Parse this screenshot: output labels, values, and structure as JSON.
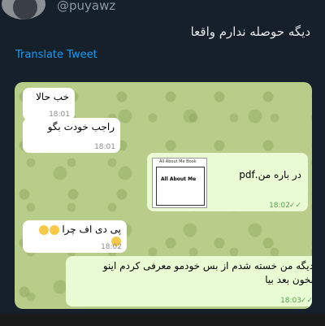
{
  "tweet": {
    "handle": "@puyawz",
    "text": "دیگه حوصله ندارم واقعا",
    "translate_label": "Translate Tweet"
  },
  "chat": {
    "messages": [
      {
        "text": "خب حالا",
        "time": "18:01",
        "direction": "incoming"
      },
      {
        "text": "راجب خودت بگو",
        "time": "18:01",
        "direction": "incoming"
      },
      {
        "file_name": "در باره من.pdf",
        "thumb_title": "All About Me Book",
        "thumb_text": "All About Me",
        "time": "18:02",
        "direction": "outgoing"
      },
      {
        "text": "پی دی اف چرا",
        "time": "18:02",
        "direction": "incoming",
        "emoji": "laughing-face"
      },
      {
        "line1": "دیگه من خسته شدم از بس خودمو معرفی کردم اینو",
        "line2": "بخون بعد بیا",
        "time": "18:03",
        "direction": "outgoing"
      }
    ],
    "read_check": "✓✓"
  },
  "colors": {
    "background": "#15202b",
    "chat_bg": "#b9cd8b",
    "incoming_bubble": "#ffffff",
    "outgoing_bubble": "#e8fbd3",
    "link": "#1d9bf0"
  }
}
